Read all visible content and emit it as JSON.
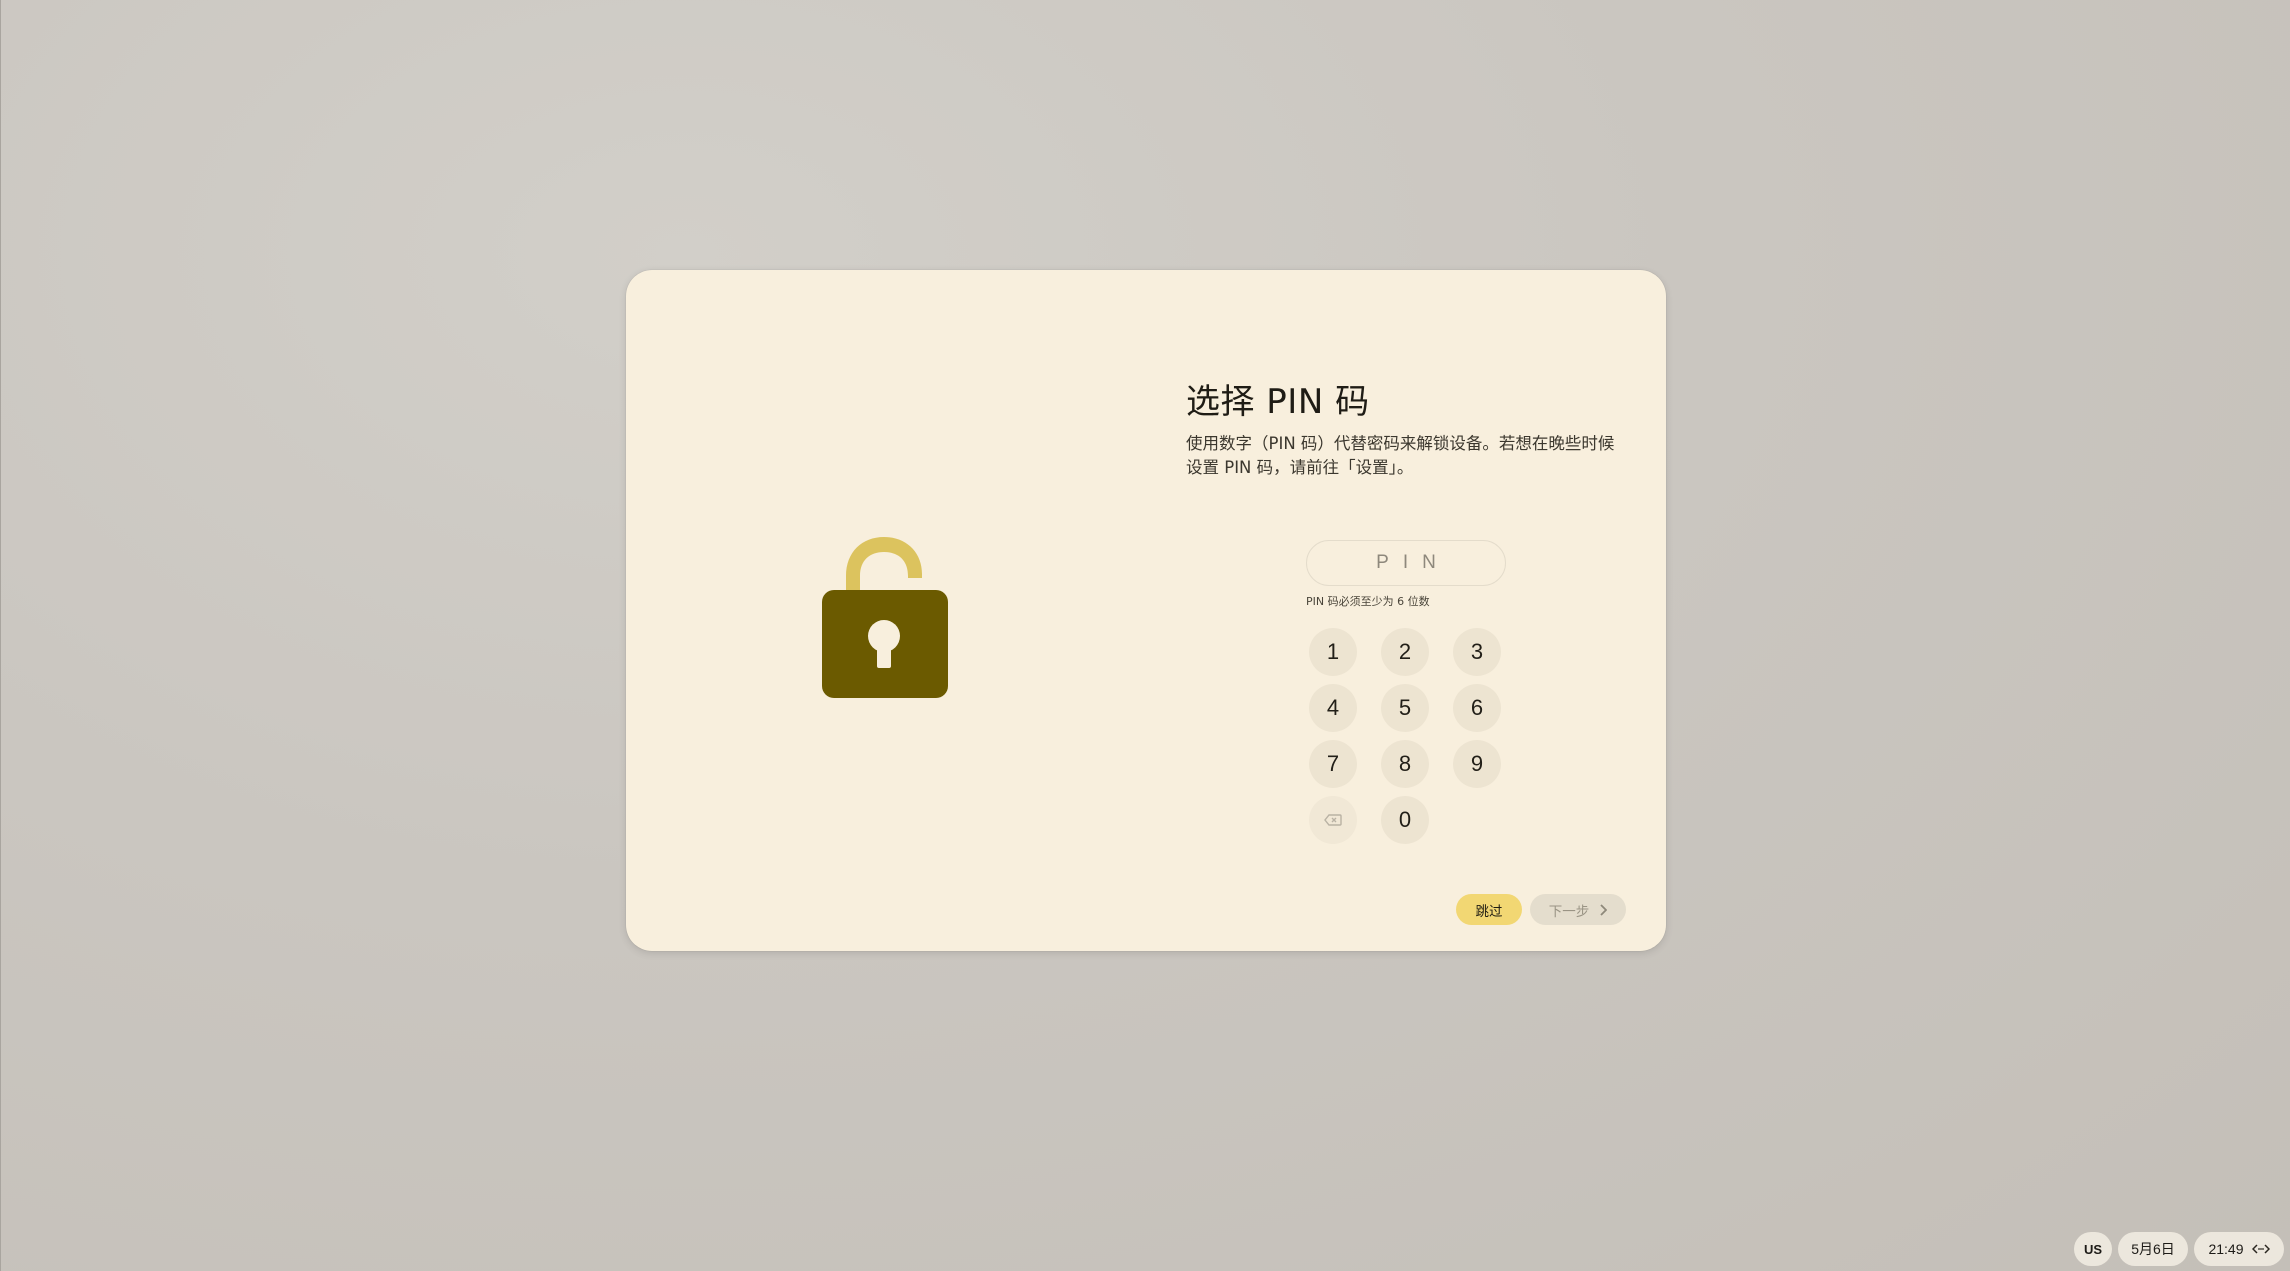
{
  "dialog": {
    "title": "选择 PIN 码",
    "description": "使用数字（PIN 码）代替密码来解锁设备。若想在晚些时候设置 PIN 码，请前往「设置」。",
    "illustration_icon": "unlocked-padlock-icon",
    "pin_field": {
      "placeholder": "PIN",
      "value": "",
      "hint": "PIN 码必须至少为 6 位数"
    },
    "keypad": {
      "keys": [
        "1",
        "2",
        "3",
        "4",
        "5",
        "6",
        "7",
        "8",
        "9",
        "0"
      ],
      "backspace_icon": "backspace-icon"
    },
    "buttons": {
      "skip_label": "跳过",
      "next_label": "下一步"
    }
  },
  "shelf": {
    "ime_label": "US",
    "date": "5月6日",
    "time": "21:49"
  },
  "colors": {
    "dialog_background": "#f8efdd",
    "lock_body": "#6b5a00",
    "lock_shackle": "#dcc35e",
    "skip_button": "#f2d773",
    "next_button_disabled": "#e4ddcd"
  }
}
